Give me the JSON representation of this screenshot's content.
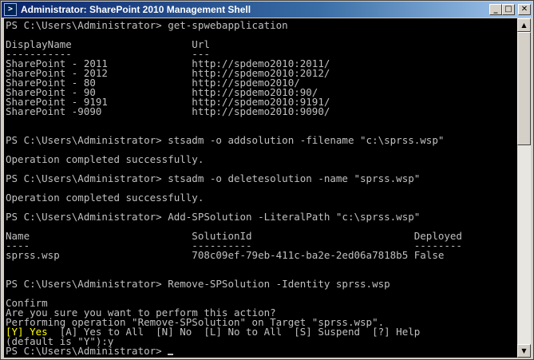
{
  "window": {
    "title": "Administrator: SharePoint 2010 Management Shell",
    "icon": "powershell-icon",
    "controls": {
      "minimize": "_",
      "maximize": "□",
      "close": "✕"
    }
  },
  "colors": {
    "console_background": "#000000",
    "console_text": "#c0c0c0",
    "highlight_text": "#ffff00",
    "titlebar_start": "#0a246a",
    "titlebar_end": "#a6caf0"
  },
  "console": {
    "lines": [
      "PS C:\\Users\\Administrator> get-spwebapplication",
      "",
      "DisplayName                    Url",
      "-----------                    ---",
      "SharePoint - 2011              http://spdemo2010:2011/",
      "SharePoint - 2012              http://spdemo2010:2012/",
      "SharePoint - 80                http://spdemo2010/",
      "SharePoint - 90                http://spdemo2010:90/",
      "SharePoint - 9191              http://spdemo2010:9191/",
      "SharePoint -9090               http://spdemo2010:9090/",
      "",
      "",
      "PS C:\\Users\\Administrator> stsadm -o addsolution -filename \"c:\\sprss.wsp\"",
      "",
      "Operation completed successfully.",
      "",
      "PS C:\\Users\\Administrator> stsadm -o deletesolution -name \"sprss.wsp\"",
      "",
      "Operation completed successfully.",
      "",
      "PS C:\\Users\\Administrator> Add-SPSolution -LiteralPath \"c:\\sprss.wsp\"",
      "",
      "Name                           SolutionId                           Deployed",
      "----                           ----------                           --------",
      "sprss.wsp                      708c09ef-79eb-411c-ba2e-2ed06a7818b5 False",
      "",
      "",
      "PS C:\\Users\\Administrator> Remove-SPSolution -Identity sprss.wsp",
      "",
      "Confirm",
      "Are you sure you want to perform this action?",
      "Performing operation \"Remove-SPSolution\" on Target \"sprss.wsp\".",
      "",
      "(default is \"Y\"):y",
      "PS C:\\Users\\Administrator> "
    ],
    "choice_line": {
      "yes": "[Y] Yes",
      "rest": "  [A] Yes to All  [N] No  [L] No to All  [S] Suspend  [?] Help"
    }
  }
}
